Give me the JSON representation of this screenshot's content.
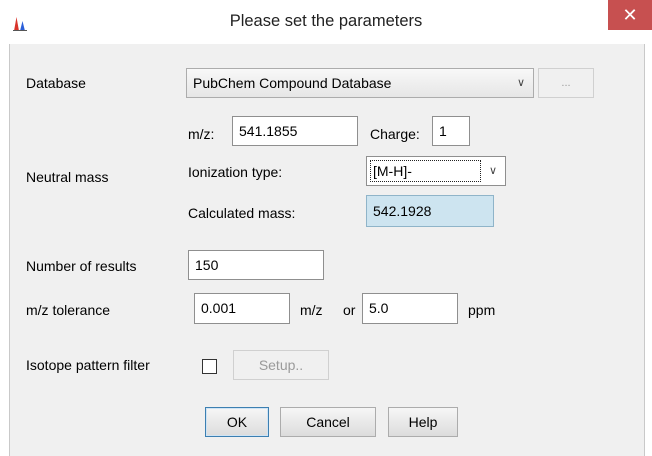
{
  "window": {
    "title": "Please set the parameters",
    "close_glyph": "✕",
    "app_icon": "peak-chart-icon",
    "accent_colors": {
      "close_button": "#c75050",
      "calculated_field": "#cde4f0"
    }
  },
  "database": {
    "label": "Database",
    "selected": "PubChem Compound Database",
    "browse_label": "..."
  },
  "neutral_mass": {
    "label": "Neutral mass",
    "mz_label": "m/z:",
    "mz_value": "541.1855",
    "charge_label": "Charge:",
    "charge_value": "1",
    "ionization_label": "Ionization type:",
    "ionization_selected": "[M-H]-",
    "calculated_label": "Calculated mass:",
    "calculated_value": "542.1928"
  },
  "results": {
    "label": "Number of results",
    "value": "150"
  },
  "tolerance": {
    "label": "m/z tolerance",
    "mz_value": "0.001",
    "mz_unit": "m/z",
    "or_label": "or",
    "ppm_value": "5.0",
    "ppm_unit": "ppm"
  },
  "isotope": {
    "label": "Isotope pattern filter",
    "checked": false,
    "setup_label": "Setup.."
  },
  "buttons": {
    "ok": "OK",
    "cancel": "Cancel",
    "help": "Help"
  }
}
